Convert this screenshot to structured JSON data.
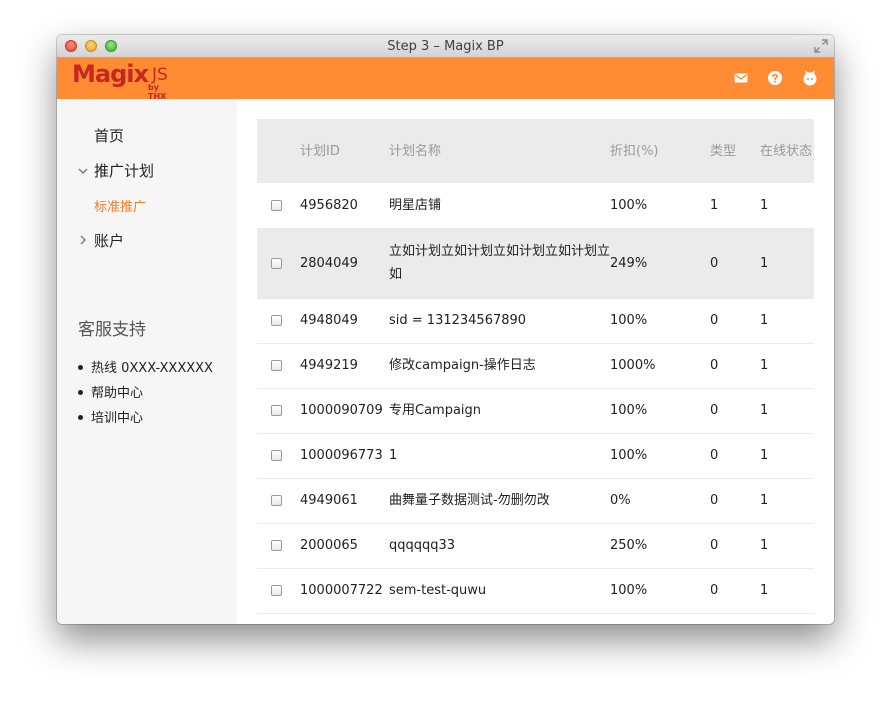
{
  "window": {
    "title": "Step 3 – Magix BP"
  },
  "brand": {
    "name": "Magix",
    "suffix": "JS",
    "byline": "by THX",
    "color": "#c8261e",
    "bar_color": "#ff8b33"
  },
  "header_icons": [
    "mail-icon",
    "help-icon",
    "user-icon"
  ],
  "sidebar": {
    "nav": {
      "home": "首页",
      "plans": "推广计划",
      "plans_sub": "标准推广",
      "account": "账户"
    },
    "support": {
      "title": "客服支持",
      "items": [
        "热线 0XXX-XXXXXX",
        "帮助中心",
        "培训中心"
      ]
    }
  },
  "table": {
    "columns": [
      "计划ID",
      "计划名称",
      "折扣(%)",
      "类型",
      "在线状态"
    ],
    "rows": [
      {
        "id": "4956820",
        "name": "明星店铺",
        "discount": "100%",
        "type": "1",
        "status": "1"
      },
      {
        "id": "2804049",
        "name": "立如计划立如计划立如计划立如计划立如",
        "discount": "249%",
        "type": "0",
        "status": "1"
      },
      {
        "id": "4948049",
        "name": "sid = 131234567890",
        "discount": "100%",
        "type": "0",
        "status": "1"
      },
      {
        "id": "4949219",
        "name": "修改campaign-操作日志",
        "discount": "1000%",
        "type": "0",
        "status": "1"
      },
      {
        "id": "1000090709",
        "name": "专用Campaign",
        "discount": "100%",
        "type": "0",
        "status": "1"
      },
      {
        "id": "1000096773",
        "name": "1",
        "discount": "100%",
        "type": "0",
        "status": "1"
      },
      {
        "id": "4949061",
        "name": "曲舞量子数据测试-勿删勿改",
        "discount": "0%",
        "type": "0",
        "status": "1"
      },
      {
        "id": "2000065",
        "name": "qqqqqq33",
        "discount": "250%",
        "type": "0",
        "status": "1"
      },
      {
        "id": "1000007722",
        "name": "sem-test-quwu",
        "discount": "100%",
        "type": "0",
        "status": "1"
      }
    ]
  }
}
